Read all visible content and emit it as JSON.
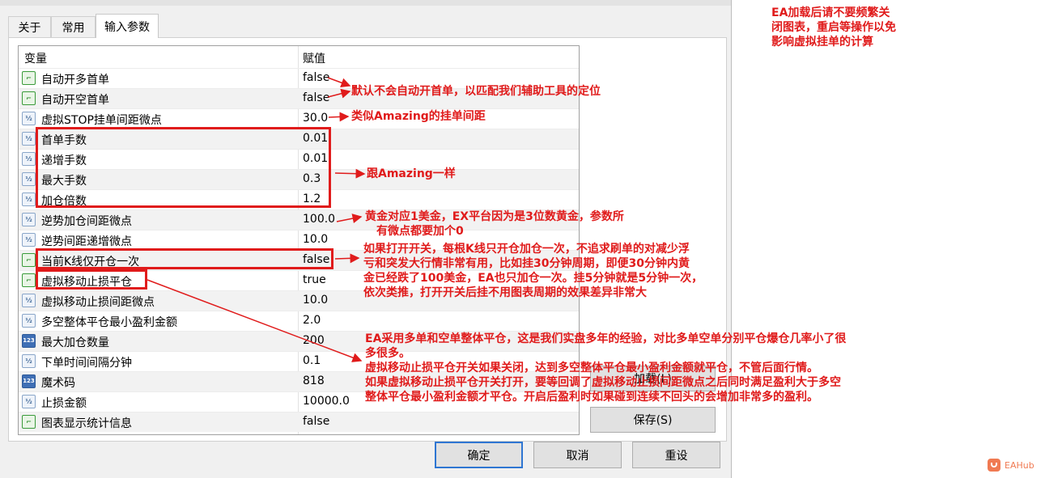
{
  "tabs": [
    {
      "label": "关于"
    },
    {
      "label": "常用"
    },
    {
      "label": "输入参数"
    }
  ],
  "grid": {
    "col_variable": "变量",
    "col_value": "赋值",
    "rows": [
      {
        "icon": "toggle-icon",
        "name": "自动开多首单",
        "value": "false"
      },
      {
        "icon": "toggle-icon",
        "name": "自动开空首单",
        "value": "false"
      },
      {
        "icon": "fraction-icon",
        "name": "虚拟STOP挂单间距微点",
        "value": "30.0"
      },
      {
        "icon": "fraction-icon",
        "name": "首单手数",
        "value": "0.01"
      },
      {
        "icon": "fraction-icon",
        "name": "递增手数",
        "value": "0.01"
      },
      {
        "icon": "fraction-icon",
        "name": "最大手数",
        "value": "0.3"
      },
      {
        "icon": "fraction-icon",
        "name": "加仓倍数",
        "value": "1.2"
      },
      {
        "icon": "fraction-icon",
        "name": "逆势加仓间距微点",
        "value": "100.0"
      },
      {
        "icon": "fraction-icon",
        "name": "逆势间距递增微点",
        "value": "10.0"
      },
      {
        "icon": "toggle-icon",
        "name": "当前K线仅开仓一次",
        "value": "false"
      },
      {
        "icon": "toggle-icon",
        "name": "虚拟移动止损平仓",
        "value": "true"
      },
      {
        "icon": "fraction-icon",
        "name": "虚拟移动止损间距微点",
        "value": "10.0"
      },
      {
        "icon": "fraction-icon",
        "name": "多空整体平仓最小盈利金额",
        "value": "2.0"
      },
      {
        "icon": "integer-icon",
        "name": "最大加仓数量",
        "value": "200"
      },
      {
        "icon": "fraction-icon",
        "name": "下单时间间隔分钟",
        "value": "0.1"
      },
      {
        "icon": "integer-icon",
        "name": "魔术码",
        "value": "818"
      },
      {
        "icon": "fraction-icon",
        "name": "止损金额",
        "value": "10000.0"
      },
      {
        "icon": "toggle-icon",
        "name": "图表显示统计信息",
        "value": "false"
      }
    ]
  },
  "icon_glyphs": {
    "toggle": "⌐",
    "fraction": "½",
    "integer": "123"
  },
  "buttons": {
    "load": "加载(L)",
    "save": "保存(S)",
    "ok": "确定",
    "cancel": "取消",
    "reset": "重设"
  },
  "annotations": {
    "top_warning": [
      "EA加载后请不要频繁关",
      "闭图表，重启等操作以免",
      "影响虚拟挂单的计算"
    ],
    "first_order": "默认不会自动开首单，以匹配我们辅助工具的定位",
    "stop_spacing": "类似Amazing的挂单间距",
    "lots_same": "跟Amazing一样",
    "gold_points": [
      "黄金对应1美金，EX平台因为是3位数黄金，参数所",
      "有微点都要加个0"
    ],
    "kline_once": [
      "如果打开开关，每根K线只开仓加仓一次，不追求刷单的对减少浮",
      "亏和突发大行情非常有用，比如挂30分钟周期，即便30分钟内黄",
      "金已经跌了100美金，EA也只加仓一次。挂5分钟就是5分钟一次，",
      "依次类推，打开开关后挂不用图表周期的效果差异非常大"
    ],
    "trailing": [
      "EA采用多单和空单整体平仓，这是我们实盘多年的经验，对比多单空单分别平仓爆仓几率小了很",
      "多很多。",
      "虚拟移动止损平仓开关如果关闭，达到多空整体平仓最小盈利金额就平仓，不管后面行情。",
      "如果虚拟移动止损平仓开关打开，要等回调了虚拟移动止损间距微点之后同时满足盈利大于多空",
      "整体平仓最小盈利金额才平仓。开启后盈利时如果碰到连续不回头的会增加非常多的盈利。"
    ]
  },
  "colors": {
    "annotation": "#e01b1b",
    "default_button_border": "#2f76d2"
  },
  "watermark": "EAHub"
}
